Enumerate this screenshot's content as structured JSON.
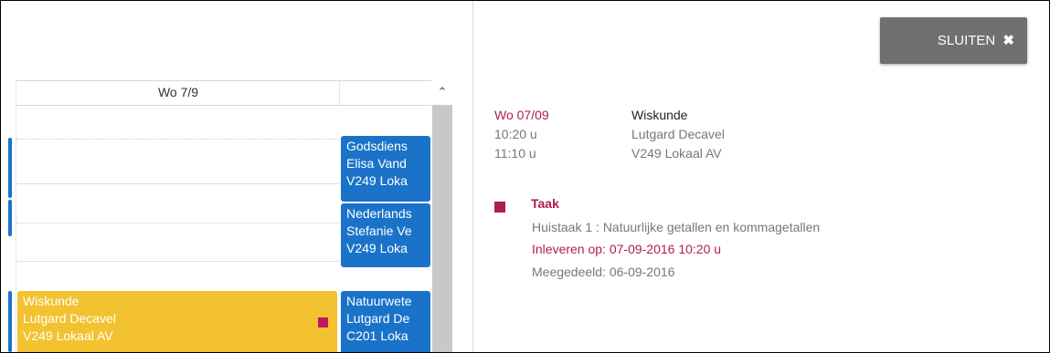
{
  "close_button": {
    "label": "SLUITEN",
    "icon": "close-icon",
    "glyph": "✖"
  },
  "calendar": {
    "day_header": "Wo 7/9",
    "scroll_up_glyph": "^",
    "events": [
      {
        "lines": [
          "Godsdiens",
          "Elisa Vand",
          "V249 Loka"
        ],
        "color": "#1a73c9"
      },
      {
        "lines": [
          "Nederlands",
          "Stefanie Ve",
          "V249 Loka"
        ],
        "color": "#1a73c9"
      },
      {
        "lines": [
          "Wiskunde",
          "Lutgard Decavel",
          "V249 Lokaal AV"
        ],
        "color": "#f2c230"
      },
      {
        "lines": [
          "Natuurwete",
          "Lutgard De",
          "C201 Loka"
        ],
        "color": "#1a73c9"
      }
    ]
  },
  "detail": {
    "date": "Wo 07/09",
    "subject": "Wiskunde",
    "start_time": "10:20 u",
    "teacher": "Lutgard Decavel",
    "end_time": "11:10 u",
    "room": "V249 Lokaal AV",
    "task": {
      "title": "Taak",
      "description": "Huistaak 1 : Natuurlijke getallen en kommagetallen",
      "due": "Inleveren op: 07-09-2016 10:20 u",
      "shared": "Meegedeeld: 06-09-2016",
      "color": "#b01c4f"
    }
  }
}
